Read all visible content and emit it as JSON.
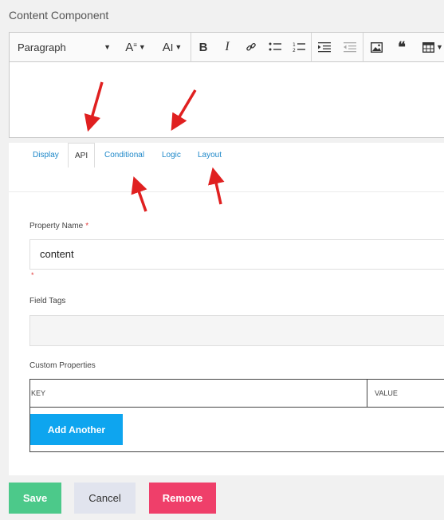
{
  "header": {
    "title": "Content Component"
  },
  "editor": {
    "format_label": "Paragraph",
    "font_size_glyph": "A",
    "font_family_glyph": "A",
    "bold": "B",
    "italic": "I",
    "link": "🔗",
    "bullets": "•–",
    "numbers": "1–",
    "indent": "⇥",
    "outdent": "⇤",
    "image": "▣",
    "quote": "❝",
    "table": "▦"
  },
  "tabs": [
    {
      "label": "Display"
    },
    {
      "label": "API"
    },
    {
      "label": "Conditional"
    },
    {
      "label": "Logic"
    },
    {
      "label": "Layout"
    }
  ],
  "form": {
    "property_name_label": "Property Name",
    "required_mark": "*",
    "property_name_value": "content",
    "field_tags_label": "Field Tags",
    "custom_properties_label": "Custom Properties",
    "key_header": "KEY",
    "value_header": "VALUE",
    "add_another": "Add Another"
  },
  "footer": {
    "save": "Save",
    "cancel": "Cancel",
    "remove": "Remove"
  },
  "colors": {
    "tab_link": "#1e88c9",
    "add_button": "#0ea5ef",
    "save": "#4cc98a",
    "cancel": "#e1e4ee",
    "remove": "#ef3f6a",
    "annotation_arrow": "#e02020"
  }
}
